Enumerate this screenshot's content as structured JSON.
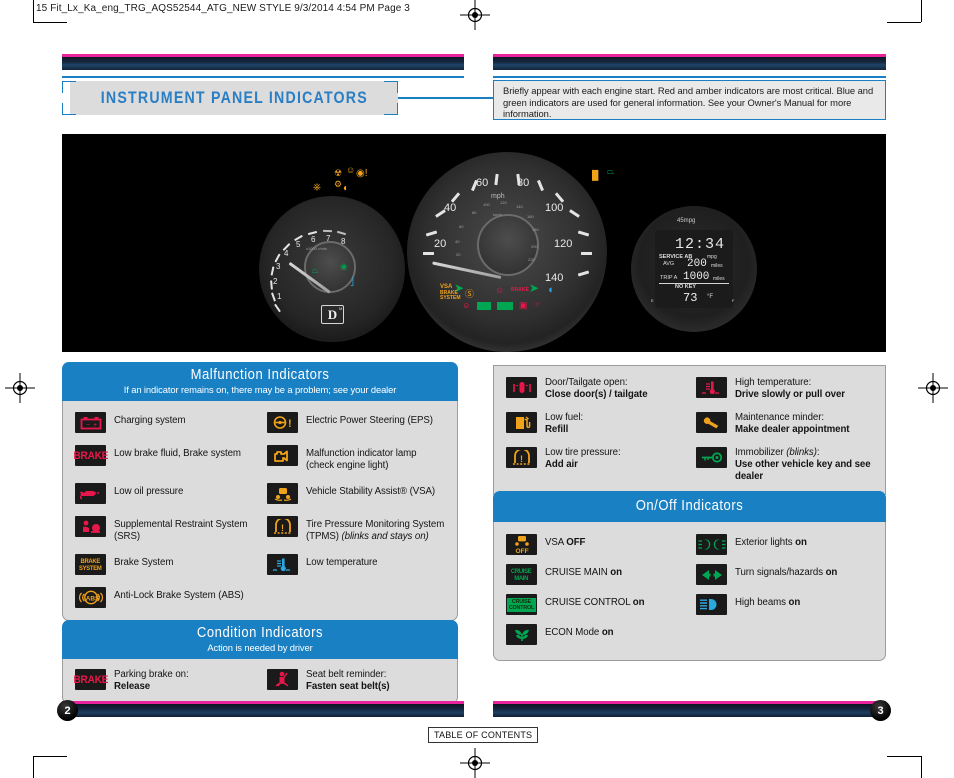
{
  "print_slug": "15 Fit_Lx_Ka_eng_TRG_AQS52544_ATG_NEW STYLE  9/3/2014  4:54 PM  Page 3",
  "page_title": "INSTRUMENT PANEL INDICATORS",
  "intro_note": "Briefly appear with each engine start. Red and amber indicators are most critical. Blue and green indicators are used for general information. See your Owner's Manual for more information.",
  "colors": {
    "accent_blue": "#1a80c4",
    "panel_gray": "#dcdcdc",
    "magenta_rule": "#e8239b",
    "red_indicator": "#e8174b",
    "amber_indicator": "#f0a21b",
    "green_indicator": "#00a651",
    "blue_indicator": "#2aa8e0"
  },
  "cluster": {
    "tachometer": {
      "unit": "x1000 r/min",
      "ticks": [
        "1",
        "2",
        "3",
        "4",
        "5",
        "6",
        "7",
        "8"
      ],
      "gear_display": "D",
      "gear_sub": "M",
      "lamps": [
        "cruise-main-icon",
        "cruise-control-icon",
        "econ-icon",
        "low-temperature-icon",
        "immobilizer-icon",
        "eps-icon",
        "check-engine-icon",
        "vsa-off-icon",
        "tpms-icon"
      ]
    },
    "speedometer": {
      "unit_primary": "mph",
      "unit_secondary": "km/h",
      "mph_ticks": [
        "20",
        "40",
        "60",
        "80",
        "100",
        "120",
        "140"
      ],
      "kmh_ticks": [
        "20",
        "40",
        "60",
        "80",
        "100",
        "120",
        "140",
        "160",
        "180",
        "200",
        "220"
      ],
      "lamps": [
        "turn-left-icon",
        "turn-right-icon",
        "high-beam-icon",
        "vsa-off-icon",
        "abs-icon",
        "srs-icon",
        "brake-icon",
        "charging-icon",
        "cruise-main-icon",
        "cruise-control-icon",
        "door-open-icon",
        "seatbelt-icon"
      ]
    },
    "info_display": {
      "top_label": "45mpg",
      "clock": "12:34",
      "service_label": "SERVICE AB",
      "service_unit": "mpg",
      "avg_label": "AVG",
      "avg_value": "200",
      "avg_unit": "miles",
      "trip_label": "TRIP A",
      "trip_value": "1000",
      "trip_unit": "miles",
      "key_status": "NO KEY",
      "temperature": "73",
      "temperature_unit": "°F",
      "fuel_left": "E",
      "fuel_right": "F"
    }
  },
  "malfunction": {
    "title": "Malfunction Indicators",
    "subtitle": "If an indicator remains on, there may be a problem; see your dealer",
    "left": [
      {
        "icon": "charging-system-icon",
        "label": "Charging system"
      },
      {
        "icon": "low-brake-fluid-icon",
        "label": "Low brake fluid, Brake system"
      },
      {
        "icon": "low-oil-pressure-icon",
        "label": "Low oil pressure"
      },
      {
        "icon": "srs-icon",
        "label": "Supplemental Restraint System (SRS)"
      },
      {
        "icon": "brake-system-icon",
        "label": "Brake System"
      },
      {
        "icon": "abs-icon",
        "label": "Anti-Lock Brake System (ABS)"
      }
    ],
    "right": [
      {
        "icon": "eps-icon",
        "label": "Electric Power Steering (EPS)"
      },
      {
        "icon": "check-engine-icon",
        "label": "Malfunction indicator lamp (check engine light)"
      },
      {
        "icon": "vsa-icon",
        "label": "Vehicle Stability Assist® (VSA)"
      },
      {
        "icon": "tpms-icon",
        "label": "Tire Pressure Monitoring System (TPMS) ",
        "label_italic": "(blinks and stays on)"
      },
      {
        "icon": "low-temperature-icon",
        "label": "Low temperature"
      }
    ]
  },
  "condition": {
    "title": "Condition Indicators",
    "subtitle": "Action is needed by driver",
    "items": [
      {
        "icon": "parking-brake-icon",
        "label": "Parking brake on:",
        "action": "Release"
      },
      {
        "icon": "seatbelt-icon",
        "label": "Seat belt reminder:",
        "action": "Fasten seat belt(s)"
      }
    ]
  },
  "warning": {
    "left": [
      {
        "icon": "door-open-icon",
        "label": "Door/Tailgate open:",
        "action": "Close door(s) / tailgate"
      },
      {
        "icon": "low-fuel-icon",
        "label": "Low fuel:",
        "action": "Refill"
      },
      {
        "icon": "tpms-icon",
        "label": "Low tire pressure:",
        "action": "Add air"
      }
    ],
    "right": [
      {
        "icon": "high-temperature-icon",
        "label": "High temperature:",
        "action": "Drive slowly or pull over"
      },
      {
        "icon": "maintenance-minder-icon",
        "label": "Maintenance minder:",
        "action": "Make dealer appointment"
      },
      {
        "icon": "immobilizer-icon",
        "label": "Immobilizer ",
        "label_italic": "(blinks)",
        "label_tail": ":",
        "action": "Use other vehicle key and see dealer"
      }
    ]
  },
  "onoff": {
    "title": "On/Off Indicators",
    "left": [
      {
        "icon": "vsa-off-icon",
        "label": "VSA ",
        "state": "OFF"
      },
      {
        "icon": "cruise-main-icon",
        "label": "CRUISE MAIN ",
        "state": "on"
      },
      {
        "icon": "cruise-control-icon",
        "label": "CRUISE CONTROL ",
        "state": "on"
      },
      {
        "icon": "econ-icon",
        "label": "ECON Mode ",
        "state": "on"
      }
    ],
    "right": [
      {
        "icon": "exterior-lights-icon",
        "label": "Exterior lights ",
        "state": "on"
      },
      {
        "icon": "turn-signal-icon",
        "label": "Turn signals/hazards ",
        "state": "on"
      },
      {
        "icon": "high-beam-icon",
        "label": "High beams ",
        "state": "on"
      }
    ]
  },
  "footer": {
    "page_left": "2",
    "page_right": "3",
    "toc_label": "TABLE OF CONTENTS"
  }
}
